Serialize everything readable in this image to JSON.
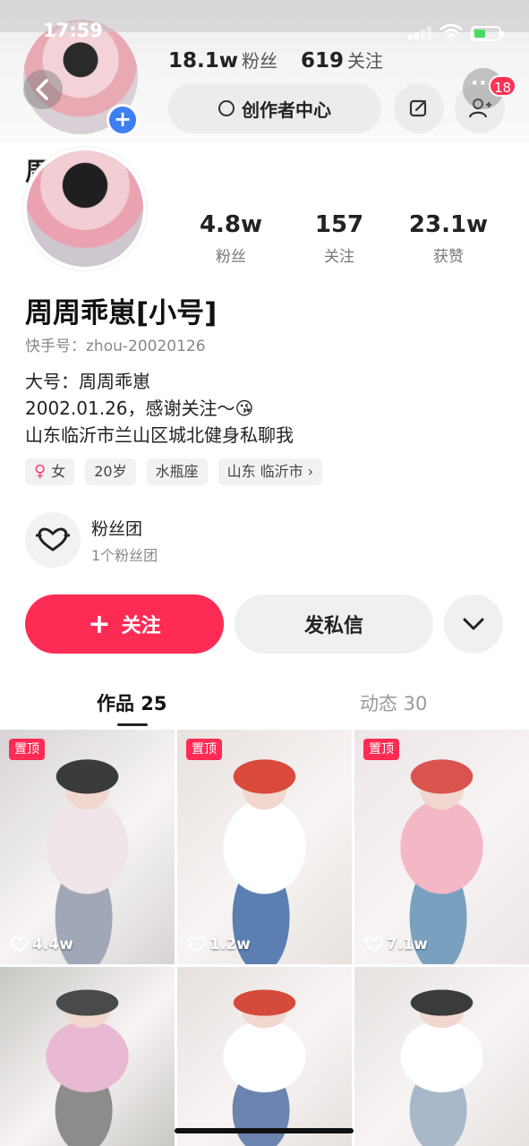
{
  "status_bar": {
    "time": "17:59"
  },
  "ghost_header": {
    "followers_value": "18.1w",
    "followers_label": "粉丝",
    "following_value": "619",
    "following_label": "关注",
    "creator_center_label": "创作者中心",
    "notification_count": "18",
    "name_fragment": "周"
  },
  "profile": {
    "stats": [
      {
        "value": "4.8w",
        "label": "粉丝"
      },
      {
        "value": "157",
        "label": "关注"
      },
      {
        "value": "23.1w",
        "label": "获赞"
      }
    ],
    "name": "周周乖崽[小号]",
    "kuaishou_id": "快手号：zhou-20020126",
    "bio": [
      "大号：周周乖崽",
      "2002.01.26，感谢关注～😘",
      "山东临沂市兰山区城北健身私聊我"
    ],
    "tags": {
      "gender": "女",
      "age": "20岁",
      "zodiac": "水瓶座",
      "location": "山东 临沂市 ›"
    },
    "fan_group": {
      "title": "粉丝团",
      "subtitle": "1个粉丝团"
    }
  },
  "actions": {
    "follow": "关注",
    "message": "发私信"
  },
  "tabs": {
    "works": "作品 25",
    "moments": "动态 30"
  },
  "grid": {
    "pinned_label": "置顶",
    "items": [
      {
        "pinned": true,
        "likes": "4.4w",
        "palette": [
          "#d8d4d6",
          "#f0e6ea",
          "#a0a8b8",
          "#3a3a3a"
        ]
      },
      {
        "pinned": true,
        "likes": "1.2w",
        "palette": [
          "#e8e2df",
          "#ffffff",
          "#5b7fb0",
          "#d94a3a"
        ]
      },
      {
        "pinned": true,
        "likes": "7.1w",
        "palette": [
          "#ede6e8",
          "#f3b7c6",
          "#7aa0c0",
          "#d9534f"
        ]
      },
      {
        "pinned": false,
        "likes": "",
        "palette": [
          "#c9c7c4",
          "#e9b9d4",
          "#8d8c8a",
          "#4a4a4a"
        ]
      },
      {
        "pinned": false,
        "likes": "",
        "palette": [
          "#e6e1df",
          "#ffffff",
          "#6c84b0",
          "#d44b3b"
        ]
      },
      {
        "pinned": false,
        "likes": "",
        "palette": [
          "#e5e2e0",
          "#ffffff",
          "#a8b8c8",
          "#3b3b3b"
        ]
      }
    ]
  }
}
